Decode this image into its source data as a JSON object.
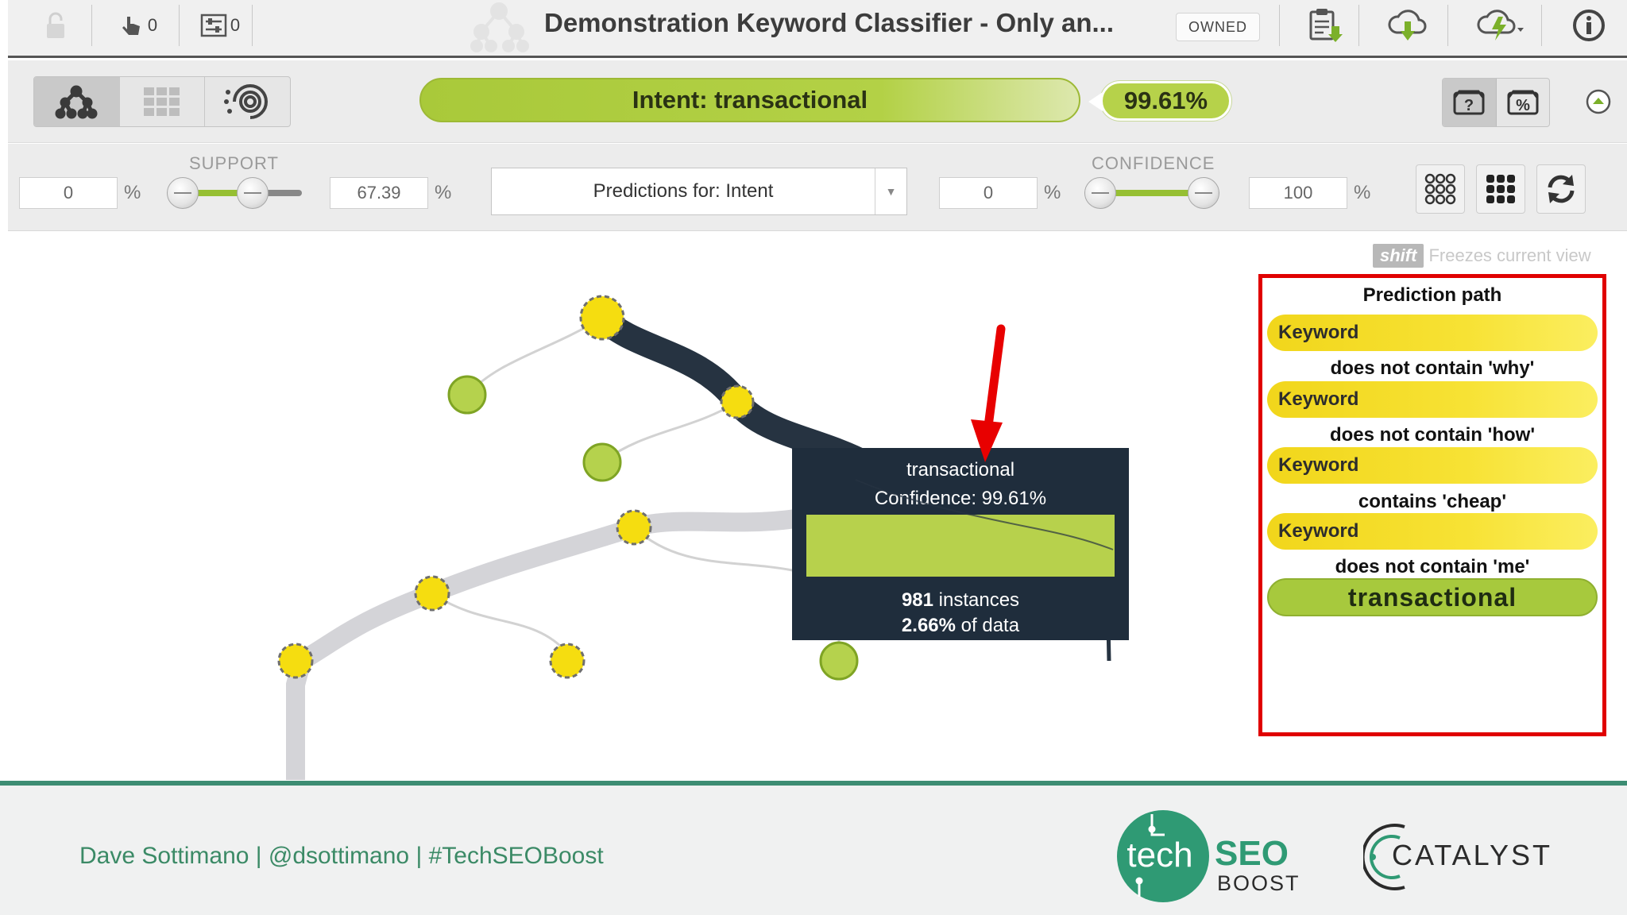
{
  "topbar": {
    "undo_count": "0",
    "filter_count": "0",
    "title": "Demonstration Keyword Classifier - Only an...",
    "owned_label": "OWNED"
  },
  "prediction": {
    "intent_label": "Intent: transactional",
    "confidence": "99.61%"
  },
  "filters": {
    "support_label": "SUPPORT",
    "support_min": "0",
    "support_max": "67.39",
    "support_range": [
      0,
      67.39
    ],
    "percent_sign": "%",
    "predictions_select": "Predictions for: Intent",
    "confidence_label": "CONFIDENCE",
    "confidence_min": "0",
    "confidence_max": "100",
    "confidence_range": [
      0,
      100
    ]
  },
  "canvas": {
    "shift_key": "shift",
    "shift_hint": "Freezes current view"
  },
  "tooltip": {
    "label": "transactional",
    "confidence": "Confidence: 99.61%",
    "instances_count": "981",
    "instances_text": "instances",
    "data_pct": "2.66%",
    "data_text": "of data"
  },
  "prediction_path": {
    "title": "Prediction path",
    "steps": [
      {
        "field": "Keyword",
        "condition": "does not contain 'why'"
      },
      {
        "field": "Keyword",
        "condition": "does not contain 'how'"
      },
      {
        "field": "Keyword",
        "condition": "contains 'cheap'"
      },
      {
        "field": "Keyword",
        "condition": "does not contain 'me'"
      }
    ],
    "result": "transactional"
  },
  "footer": {
    "credits": "Dave Sottimano |  @dsottimano   |  #TechSEOBoost",
    "techseo_a": "tech",
    "techseo_b": "SEO",
    "techseo_c": "BOOST",
    "catalyst": "CATALYST"
  },
  "colors": {
    "accent_green": "#b3d146",
    "node_yellow": "#f5dd10",
    "path_dark": "#263341",
    "highlight_red": "#e00000",
    "footer_green": "#3d8d73"
  }
}
